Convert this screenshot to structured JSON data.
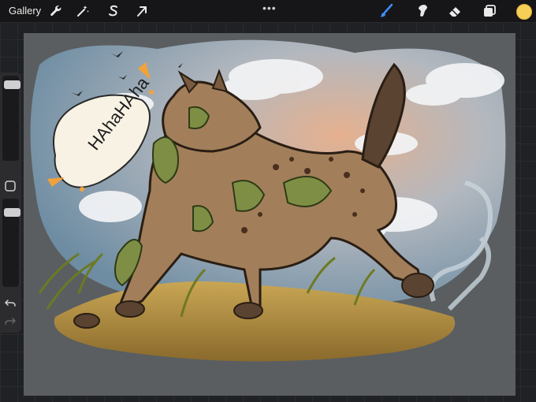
{
  "app": {
    "gallery_label": "Gallery",
    "menu_dots": "•••"
  },
  "toolbar_left": [
    {
      "name": "actions-wrench-icon",
      "icon": "wrench"
    },
    {
      "name": "adjustments-magic-wand-icon",
      "icon": "magic-wand"
    },
    {
      "name": "selection-s-icon",
      "icon": "selection"
    },
    {
      "name": "transform-arrow-icon",
      "icon": "arrow-cursor"
    }
  ],
  "toolbar_right": [
    {
      "name": "brush-icon",
      "icon": "brush",
      "color": "#3f8cff"
    },
    {
      "name": "smudge-icon",
      "icon": "smudge"
    },
    {
      "name": "eraser-icon",
      "icon": "eraser"
    },
    {
      "name": "layers-icon",
      "icon": "layers"
    }
  ],
  "current_color": "#f6cf57",
  "artwork": {
    "speech_text": "HAhaHAha"
  },
  "sidebar": {
    "brush_size_level": 0.85,
    "opacity_level": 0.6
  }
}
